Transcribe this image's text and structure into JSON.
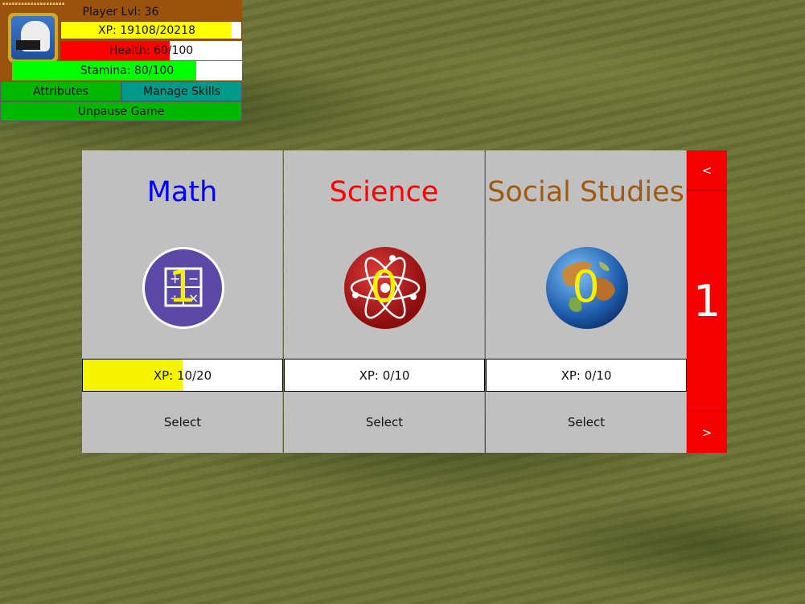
{
  "hud": {
    "player_level": "Player Lvl: 36",
    "xp": {
      "text": "XP: 19108/20218",
      "fraction": 0.945,
      "color": "#ffff00"
    },
    "health": {
      "text": "Health: 60/100",
      "fraction": 0.6,
      "color": "#ff0000"
    },
    "stamina": {
      "text": "Stamina: 80/100",
      "fraction": 0.8,
      "color": "#00ff00"
    },
    "attributes_label": "Attributes",
    "manage_skills_label": "Manage Skills",
    "unpause_label": "Unpause Game",
    "colors": {
      "panel": "#9a520c",
      "attributes_bg": "#00b800",
      "manage_skills_bg": "#009a8a",
      "unpause_bg": "#00b800"
    }
  },
  "skills": [
    {
      "title": "Math",
      "title_color": "#0000ff",
      "icon": "math-operators-icon",
      "level": "1",
      "xp_text": "XP: 10/20",
      "xp_fraction": 0.5,
      "select_label": "Select"
    },
    {
      "title": "Science",
      "title_color": "#ff0000",
      "icon": "atom-icon",
      "level": "0",
      "xp_text": "XP: 0/10",
      "xp_fraction": 0,
      "select_label": "Select"
    },
    {
      "title": "Social Studies",
      "title_color": "#a05a10",
      "icon": "globe-icon",
      "level": "0",
      "xp_text": "XP: 0/10",
      "xp_fraction": 0,
      "select_label": "Select"
    }
  ],
  "pager": {
    "prev_label": "<",
    "page": "1",
    "next_label": ">"
  }
}
